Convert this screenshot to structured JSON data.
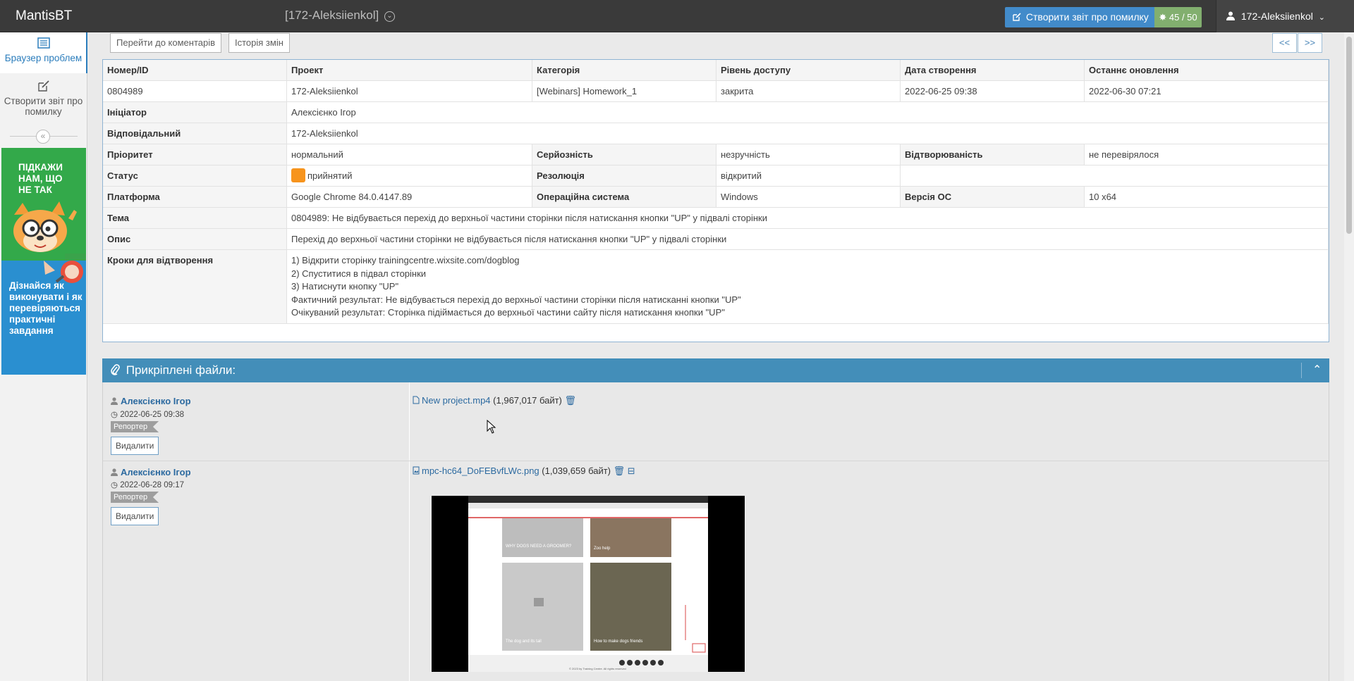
{
  "navbar": {
    "brand": "MantisBT",
    "project": "[172-Aleksiienkol]",
    "report_label": "Створити звіт про помилку",
    "count": "45 / 50",
    "user": "172-Aleksiienkol"
  },
  "sidebar": {
    "items": [
      {
        "label": "Браузер проблем",
        "icon": "list-icon",
        "active": true
      },
      {
        "label": "Створити звіт про помилку",
        "icon": "edit-icon",
        "active": false
      }
    ],
    "ad1": "ПІДКАЖИ НАМ, ЩО НЕ ТАК",
    "ad2": "Дізнайся як виконувати і як перевіряються практичні завдання"
  },
  "toolbar": {
    "goto_comments": "Перейти до коментарів",
    "history": "Історія змін",
    "prev": "<<",
    "next": ">>"
  },
  "issue": {
    "headers": [
      "Номер/ID",
      "Проект",
      "Категорія",
      "Рівень доступу",
      "Дата створення",
      "Останнє оновлення"
    ],
    "values": [
      "0804989",
      "172-Aleksiienkol",
      "[Webinars] Homework_1",
      "закрита",
      "2022-06-25 09:38",
      "2022-06-30 07:21"
    ],
    "reporter_label": "Ініціатор",
    "reporter": "Алексієнко Ігор",
    "handler_label": "Відповідальний",
    "handler": "172-Aleksiienkol",
    "priority_label": "Пріоритет",
    "priority": "нормальний",
    "severity_label": "Серйозність",
    "severity": "незручність",
    "reproducibility_label": "Відтворюваність",
    "reproducibility": "не перевірялося",
    "status_label": "Статус",
    "status": "прийнятий",
    "status_color": "#f7941d",
    "resolution_label": "Резолюція",
    "resolution": "відкритий",
    "platform_label": "Платформа",
    "platform": "Google Chrome 84.0.4147.89",
    "os_label": "Операційна система",
    "os": "Windows",
    "os_version_label": "Версія ОС",
    "os_version": "10 x64",
    "summary_label": "Тема",
    "summary": "0804989: Не відбувається перехід до верхньої частини сторінки після натискання кнопки \"UP\" у підвалі сторінки",
    "description_label": "Опис",
    "description": "Перехід до верхньої частини сторінки не відбувається після натискання кнопки \"UP\" у підвалі сторінки",
    "steps_label": "Кроки для відтворення",
    "steps": [
      "1) Відкрити сторінку trainingcentre.wixsite.com/dogblog",
      "2) Спуститися в підвал сторінки",
      "3) Натиснути кнопку \"UP\"",
      "Фактичний результат: Не відбувається перехід до верхньої частини сторінки після натисканні кнопки \"UP\"",
      "Очікуваний результат: Сторінка підіймається до верхньої частини сайту після натискання кнопки \"UP\""
    ]
  },
  "attachments": {
    "title": "Прикріплені файли:",
    "items": [
      {
        "author": "Алексієнко Ігор",
        "date": "2022-06-25 09:38",
        "role": "Репортер",
        "delete": "Видалити",
        "file": "New project.mp4",
        "size": "(1,967,017 байт)"
      },
      {
        "author": "Алексієнко Ігор",
        "date": "2022-06-28 09:17",
        "role": "Репортер",
        "delete": "Видалити",
        "file": "mpc-hc64_DoFEBvfLWc.png",
        "size": "(1,039,659 байт)"
      }
    ],
    "preview": {
      "tile1": "WHY DOGS NEED A GROOMER?",
      "tile2": "Zoo help",
      "tile3": "The dog and its tail",
      "tile4": "How to make dogs friends",
      "footer": "© 2023 by Training Centre. All rights reserved"
    }
  }
}
